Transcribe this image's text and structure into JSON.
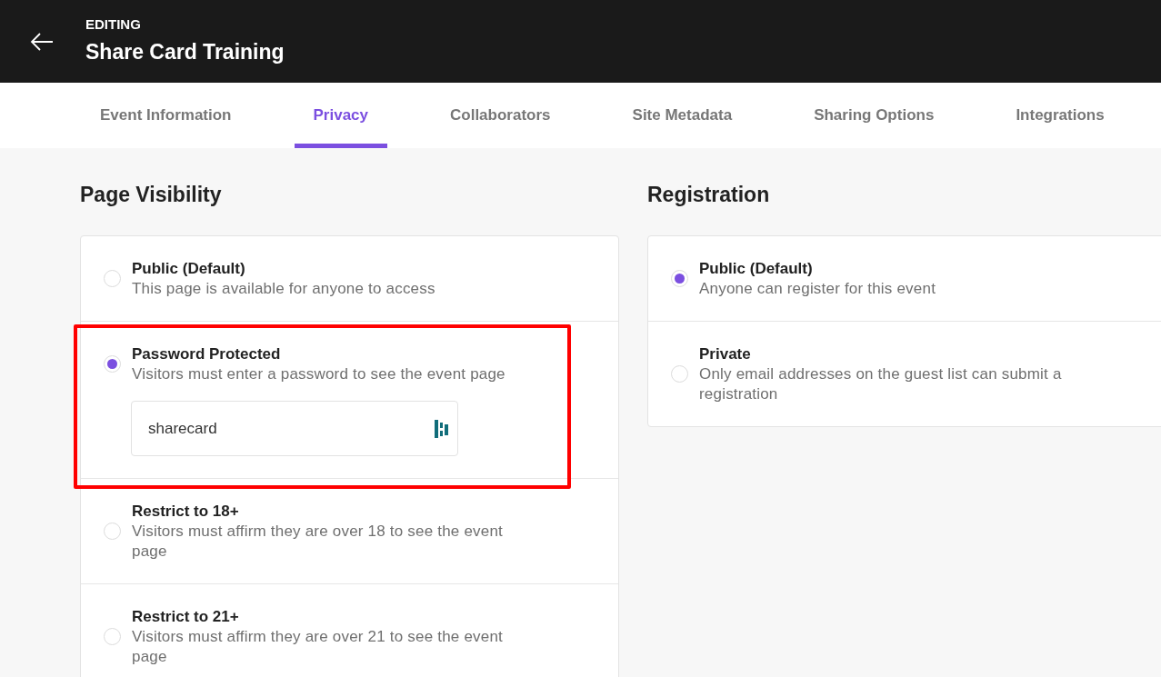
{
  "header": {
    "eyebrow": "EDITING",
    "title": "Share Card Training"
  },
  "tabs": [
    {
      "label": "Event Information",
      "selected": false
    },
    {
      "label": "Privacy",
      "selected": true
    },
    {
      "label": "Collaborators",
      "selected": false
    },
    {
      "label": "Site Metadata",
      "selected": false
    },
    {
      "label": "Sharing Options",
      "selected": false
    },
    {
      "label": "Integrations",
      "selected": false
    }
  ],
  "page_visibility": {
    "heading": "Page Visibility",
    "options": [
      {
        "title": "Public (Default)",
        "description": "This page is available for anyone to access",
        "selected": false,
        "highlighted": false
      },
      {
        "title": "Password Protected",
        "description": "Visitors must enter a password to see the event page",
        "selected": true,
        "highlighted": true,
        "password": "sharecard"
      },
      {
        "title": "Restrict to 18+",
        "description": "Visitors must affirm they are over 18 to see the event page",
        "selected": false,
        "highlighted": false
      },
      {
        "title": "Restrict to 21+",
        "description": "Visitors must affirm they are over 21 to see the event page",
        "selected": false,
        "highlighted": false
      }
    ]
  },
  "registration": {
    "heading": "Registration",
    "options": [
      {
        "title": "Public (Default)",
        "description": "Anyone can register for this event",
        "selected": true,
        "highlighted": false
      },
      {
        "title": "Private",
        "description": "Only email addresses on the guest list can submit a registration",
        "selected": false,
        "highlighted": false
      }
    ]
  }
}
